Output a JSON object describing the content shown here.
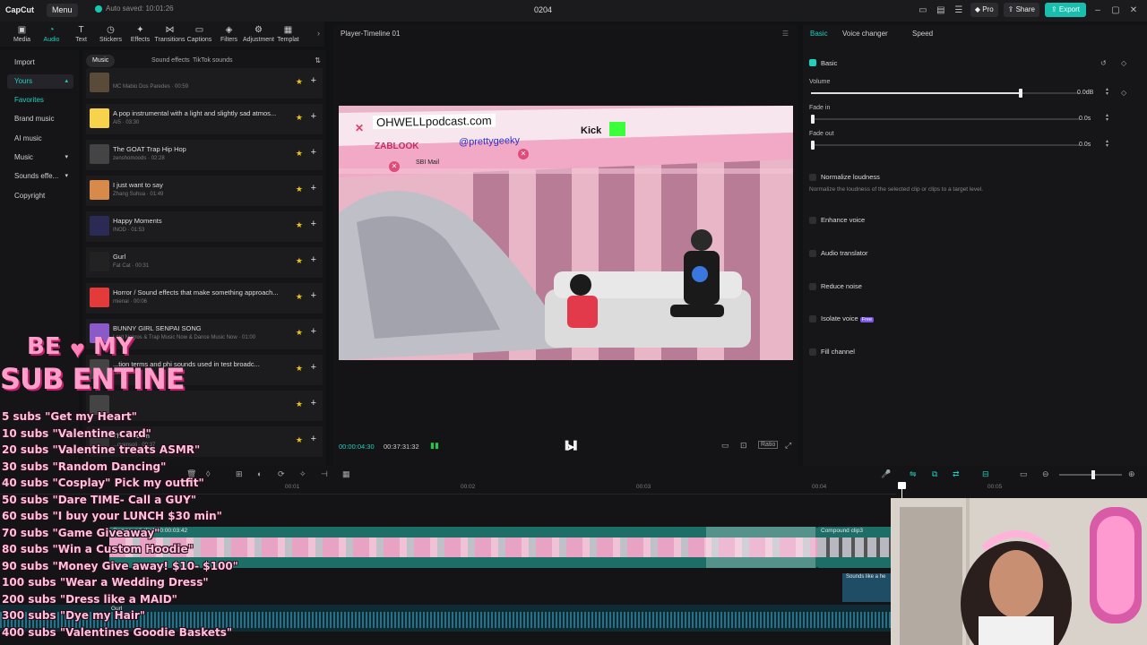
{
  "titlebar": {
    "logo": "CapCut",
    "menu": "Menu",
    "autosave": "Auto saved: 10:01:26",
    "project": "0204",
    "pro": "Pro",
    "share": "Share",
    "export": "Export"
  },
  "tools": [
    {
      "label": "Media",
      "icon": "media-icon"
    },
    {
      "label": "Audio",
      "icon": "audio-icon"
    },
    {
      "label": "Text",
      "icon": "text-icon"
    },
    {
      "label": "Stickers",
      "icon": "stickers-icon"
    },
    {
      "label": "Effects",
      "icon": "effects-icon"
    },
    {
      "label": "Transitions",
      "icon": "transitions-icon"
    },
    {
      "label": "Captions",
      "icon": "captions-icon"
    },
    {
      "label": "Filters",
      "icon": "filters-icon"
    },
    {
      "label": "Adjustment",
      "icon": "adjustment-icon"
    },
    {
      "label": "Templat",
      "icon": "templates-icon"
    }
  ],
  "leftnav": {
    "import": "Import",
    "yours": "Yours",
    "favorites": "Favorites",
    "brand": "Brand music",
    "ai": "AI music",
    "music": "Music",
    "sounds": "Sounds effe...",
    "copyright": "Copyright"
  },
  "library": {
    "tabs": [
      "Music",
      "Sound effects",
      "TikTok sounds"
    ],
    "tracks": [
      {
        "title": "",
        "sub": "MC Mabio Dos Paredes · 00:59",
        "color": "#5a4a3a"
      },
      {
        "title": "A pop instrumental with a light and slightly sad atmos...",
        "sub": "AI5 · 03:30",
        "color": "#f6d34a"
      },
      {
        "title": "The GOAT Trap Hip Hop",
        "sub": "zenshomoods · 02:28",
        "color": "#444"
      },
      {
        "title": "I just want to say",
        "sub": "Zhang Suhua · 01:49",
        "color": "#d88a4a"
      },
      {
        "title": "Happy Moments",
        "sub": "INOD · 01:53",
        "color": "#2a2a55"
      },
      {
        "title": "Gurl",
        "sub": "Fat Cat · 00:31",
        "color": "#222"
      },
      {
        "title": "Horror / Sound effects that make something approach...",
        "sub": "mienai · 00:06",
        "color": "#e43a3a"
      },
      {
        "title": "BUNNY GIRL SENPAI SONG",
        "sub": "Lord Nekros & Trap Music Now & Dance Music Now · 01:00",
        "color": "#8a5ac8"
      },
      {
        "title": "...tion terms and phi sounds used in test broadc...",
        "sub": "00:02",
        "color": "#444"
      },
      {
        "title": "",
        "sub": "",
        "color": "#444"
      },
      {
        "title": "The Scream",
        "sub": "...ovensoli · 00:37",
        "color": "#333"
      }
    ]
  },
  "player": {
    "title": "Player-Timeline 01",
    "current": "00:00:04:30",
    "total": "00:37:31:32",
    "ratio": "Ratio",
    "video_texts": {
      "url": "OHWELLpodcast.com",
      "handle": "@prettygeeky",
      "kick": "Kick",
      "zablook": "ZABLOOK",
      "mail": "SBI Mail"
    }
  },
  "inspector": {
    "tabs": [
      "Basic",
      "Voice changer",
      "Speed"
    ],
    "basic_header": "Basic",
    "volume": {
      "label": "Volume",
      "value": "0.0dB",
      "level": 0.78
    },
    "fade_in": {
      "label": "Fade in",
      "value": "0.0s"
    },
    "fade_out": {
      "label": "Fade out",
      "value": "0.0s"
    },
    "normalize": "Normalize loudness",
    "normalize_desc": "Normalize the loudness of the selected clip or clips to a target level.",
    "enhance": "Enhance voice",
    "translator": "Audio translator",
    "reduce": "Reduce noise",
    "isolate": "Isolate voice",
    "isolate_badge": "Free",
    "fill": "Fill channel"
  },
  "timeline": {
    "ruler": [
      "00:01",
      "00:02",
      "00:03",
      "00:04",
      "00:05"
    ],
    "clip1": "Compound clip4  00:00:03:42",
    "clip2": "Compound clip3",
    "clip3": "Sounds like a he",
    "audio_label": "Gurl"
  },
  "overlay": {
    "be": "BE",
    "my": "MY",
    "subentine": "SUB ENTINE",
    "lines": [
      "5 subs \"Get my Heart\"",
      "10 subs \"Valentine card\"",
      "20 subs \"Valentine treats ASMR\"",
      "30 subs \"Random Dancing\"",
      "40 subs \"Cosplay\" Pick my outfit\"",
      "50 subs \"Dare TIME- Call a GUY\"",
      "60 subs \"I buy your LUNCH $30 min\"",
      "70 subs \"Game Giveaway\"",
      "80 subs \"Win a Custom Hoodie\"",
      "90 subs \"Money Give away! $10- $100\"",
      "100 subs \"Wear a Wedding Dress\"",
      "200 subs \"Dress like a MAID\"",
      "300 subs \"Dye my Hair\"",
      "400 subs \"Valentines Goodie Baskets\""
    ]
  },
  "colors": {
    "accent": "#1fd0bd",
    "export": "#18bfae",
    "star": "#f2c21b"
  }
}
